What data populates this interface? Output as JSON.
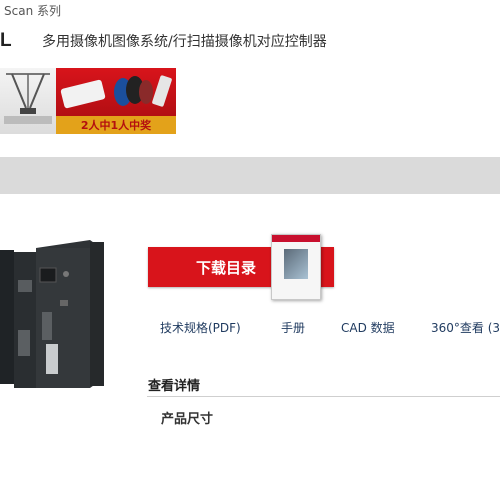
{
  "header": {
    "series": "Scan 系列",
    "model_letter": "L",
    "description": "多用摄像机图像系统/行扫描摄像机对应控制器"
  },
  "promo": {
    "caption": "2人中1人中奖"
  },
  "download": {
    "label": "下载目录"
  },
  "links": {
    "specs": "技术规格(PDF)",
    "manual": "手册",
    "cad": "CAD 数据",
    "view360": "360°查看 (3"
  },
  "details": {
    "heading": "查看详情",
    "dimensions": "产品尺寸"
  },
  "colors": {
    "accent_red": "#d8141b",
    "link": "#1f3a5f",
    "promo_strip": "#e3a21a"
  }
}
